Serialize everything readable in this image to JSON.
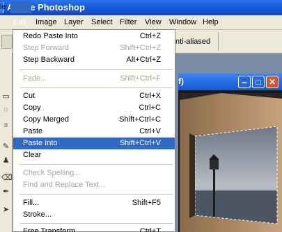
{
  "app": {
    "title": "Adobe Photoshop"
  },
  "menubar": {
    "items": [
      "le",
      "Edit",
      "Image",
      "Layer",
      "Select",
      "Filter",
      "View",
      "Window",
      "Help"
    ]
  },
  "optionsbar": {
    "antialias_label": "nti-aliased"
  },
  "document": {
    "title_fragment": "f)"
  },
  "edit_menu": {
    "items": [
      {
        "label": "Redo Paste Into",
        "shortcut": "Ctrl+Z",
        "enabled": true
      },
      {
        "label": "Step Forward",
        "shortcut": "Shift+Ctrl+Z",
        "enabled": false
      },
      {
        "label": "Step Backward",
        "shortcut": "Alt+Ctrl+Z",
        "enabled": true
      },
      {
        "label": "Fade...",
        "shortcut": "Shift+Ctrl+F",
        "enabled": false
      },
      {
        "label": "Cut",
        "shortcut": "Ctrl+X",
        "enabled": true
      },
      {
        "label": "Copy",
        "shortcut": "Ctrl+C",
        "enabled": true
      },
      {
        "label": "Copy Merged",
        "shortcut": "Shift+Ctrl+C",
        "enabled": true
      },
      {
        "label": "Paste",
        "shortcut": "Ctrl+V",
        "enabled": true
      },
      {
        "label": "Paste Into",
        "shortcut": "Shift+Ctrl+V",
        "enabled": true,
        "selected": true
      },
      {
        "label": "Clear",
        "shortcut": "",
        "enabled": true
      },
      {
        "label": "Check Spelling...",
        "shortcut": "",
        "enabled": false
      },
      {
        "label": "Find and Replace Text...",
        "shortcut": "",
        "enabled": false
      },
      {
        "label": "Fill...",
        "shortcut": "Shift+F5",
        "enabled": true
      },
      {
        "label": "Stroke...",
        "shortcut": "",
        "enabled": true
      },
      {
        "label": "Free Transform",
        "shortcut": "Ctrl+T",
        "enabled": true
      }
    ]
  },
  "colors": {
    "selection": "#316ac5",
    "titlebar": "#0c49c8",
    "menu_bg": "#ece9d8",
    "disabled_text": "#a7a69d"
  },
  "icons": [
    "marquee-icon",
    "lasso-icon",
    "crop-icon",
    "brush-icon",
    "stamp-icon",
    "eraser-icon",
    "pen-icon",
    "move-icon"
  ]
}
